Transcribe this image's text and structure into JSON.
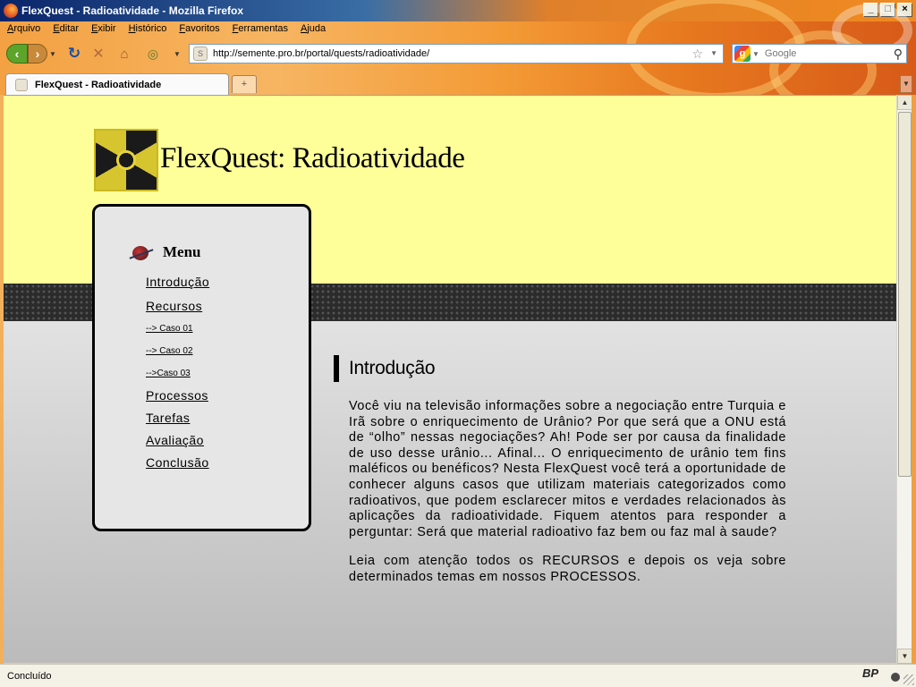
{
  "window": {
    "title": "FlexQuest - Radioatividade - Mozilla Firefox",
    "minimize": "_",
    "maximize": "□",
    "close": "×"
  },
  "menubar": [
    "Arquivo",
    "Editar",
    "Exibir",
    "Histórico",
    "Favoritos",
    "Ferramentas",
    "Ajuda"
  ],
  "address": {
    "url": "http://semente.pro.br/portal/quests/radioatividade/"
  },
  "search": {
    "placeholder": "Google"
  },
  "tab": {
    "label": "FlexQuest - Radioatividade"
  },
  "page": {
    "site_title": "FlexQuest: Radioatividade",
    "menu": {
      "title": "Menu",
      "items": [
        {
          "label": "Introdução"
        },
        {
          "label": "Recursos"
        },
        {
          "label": "--> Caso 01"
        },
        {
          "label": "--> Caso 02"
        },
        {
          "label": "-->Caso 03"
        },
        {
          "label": "Processos"
        },
        {
          "label": "Tarefas"
        },
        {
          "label": "Avaliação"
        },
        {
          "label": "Conclusão"
        }
      ]
    },
    "content": {
      "heading": "Introdução",
      "paragraphs": [
        "Você viu na televisão informações sobre a negociação entre Turquia e Irã sobre o enriquecimento de Urânio? Por que será que a ONU está de “olho” nessas negociações? Ah! Pode ser por causa da finalidade de uso desse urânio... Afinal... O enriquecimento de urânio tem fins maléficos ou benéficos? Nesta FlexQuest você terá a oportunidade de conhecer alguns casos que utilizam materiais categorizados como radioativos, que podem esclarecer mitos e verdades relacionados às aplicações da radioatividade. Fiquem atentos para responder a perguntar: Será que material radioativo faz bem ou faz mal à saude?",
        "Leia com atenção todos os RECURSOS e depois os veja sobre determinados temas em nossos PROCESSOS."
      ]
    }
  },
  "status": {
    "text": "Concluído",
    "badge": "BP"
  }
}
